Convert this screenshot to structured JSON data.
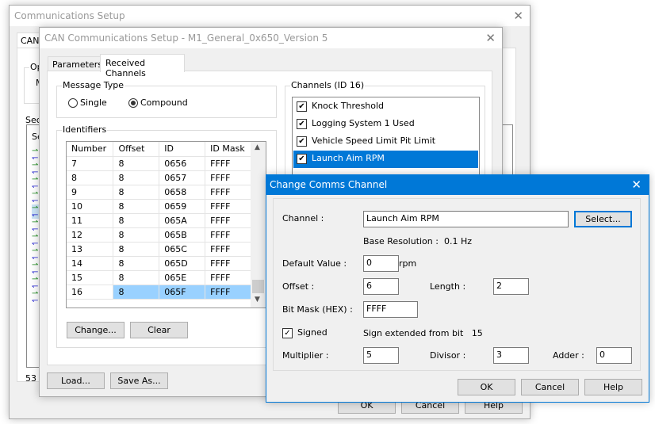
{
  "outer": {
    "title": "Communications Setup",
    "tab": "CAN",
    "group_partial": "Op",
    "field_partial": "M",
    "section_label": "Sect",
    "list_header_partial": "Se",
    "count_partial": "53 a",
    "buttons": [
      "OK",
      "Cancel",
      "Help"
    ]
  },
  "inner": {
    "title": "CAN Communications Setup - M1_General_0x650_Version 5",
    "tabs": [
      "Parameters",
      "Received Channels"
    ],
    "active_tab": "Received Channels",
    "message_type": {
      "label": "Message Type",
      "options": [
        "Single",
        "Compound"
      ],
      "selected": "Compound"
    },
    "identifiers": {
      "label": "Identifiers",
      "columns": [
        "Number",
        "Offset",
        "ID",
        "ID Mask"
      ],
      "rows": [
        [
          "7",
          "8",
          "0656",
          "FFFF"
        ],
        [
          "8",
          "8",
          "0657",
          "FFFF"
        ],
        [
          "9",
          "8",
          "0658",
          "FFFF"
        ],
        [
          "10",
          "8",
          "0659",
          "FFFF"
        ],
        [
          "11",
          "8",
          "065A",
          "FFFF"
        ],
        [
          "12",
          "8",
          "065B",
          "FFFF"
        ],
        [
          "13",
          "8",
          "065C",
          "FFFF"
        ],
        [
          "14",
          "8",
          "065D",
          "FFFF"
        ],
        [
          "15",
          "8",
          "065E",
          "FFFF"
        ],
        [
          "16",
          "8",
          "065F",
          "FFFF"
        ]
      ],
      "selected_number": "16",
      "change_label": "Change...",
      "clear_label": "Clear"
    },
    "channels": {
      "label": "Channels (ID 16)",
      "items": [
        {
          "label": "Knock Threshold",
          "checked": true
        },
        {
          "label": "Logging System 1 Used",
          "checked": true
        },
        {
          "label": "Vehicle Speed Limit Pit Limit",
          "checked": true
        },
        {
          "label": "Launch Aim RPM",
          "checked": true,
          "selected": true
        }
      ]
    },
    "load_label": "Load...",
    "save_as_label": "Save As..."
  },
  "dialog": {
    "title": "Change Comms Channel",
    "channel_label": "Channel :",
    "channel_value": "Launch Aim RPM",
    "select_label": "Select...",
    "base_resolution_label": "Base Resolution :",
    "base_resolution_value": "0.1 Hz",
    "default_value_label": "Default Value :",
    "default_value": "0",
    "default_unit": "rpm",
    "offset_label": "Offset :",
    "offset_value": "6",
    "length_label": "Length :",
    "length_value": "2",
    "bitmask_label": "Bit Mask (HEX) :",
    "bitmask_value": "FFFF",
    "signed_label": "Signed",
    "signed_checked": true,
    "sign_ext_label": "Sign extended from bit",
    "sign_ext_value": "15",
    "multiplier_label": "Multiplier :",
    "multiplier_value": "5",
    "divisor_label": "Divisor :",
    "divisor_value": "3",
    "adder_label": "Adder :",
    "adder_value": "0",
    "ok_label": "OK",
    "cancel_label": "Cancel",
    "help_label": "Help"
  },
  "colors": {
    "accent": "#0078d7",
    "selection": "#99d1ff",
    "arrow_green": "#1a8a1a",
    "arrow_blue": "#1a1ad0"
  }
}
